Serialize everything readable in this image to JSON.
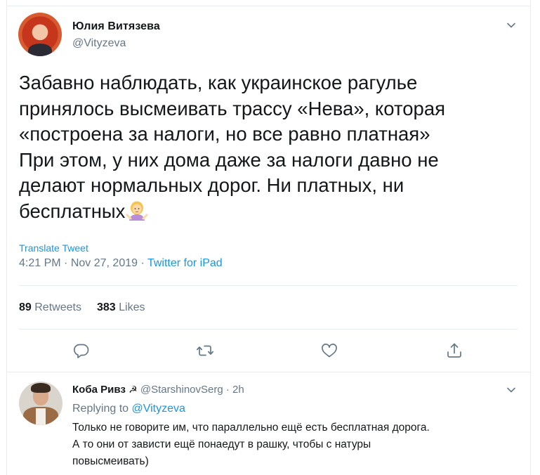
{
  "tweet": {
    "author": {
      "name": "Юлия Витязева",
      "handle": "@Vityzeva"
    },
    "text_lines": [
      "Забавно наблюдать, как украинское рагулье",
      "принялось высмеивать трассу «Нева», которая",
      "«построена за налоги, но все равно платная»",
      "При этом, у них дома даже за налоги давно не",
      "делают нормальных дорог.  Ни платных, ни",
      "бесплатных"
    ],
    "emoji": "woman-shrugging-emoji",
    "translate_label": "Translate Tweet",
    "time": "4:21 PM",
    "date": "Nov 27, 2019",
    "separator": "·",
    "source": "Twitter for iPad",
    "stats": {
      "retweets_count": "89",
      "retweets_label": "Retweets",
      "likes_count": "383",
      "likes_label": "Likes"
    },
    "actions": [
      {
        "name": "reply",
        "icon": "reply-icon"
      },
      {
        "name": "retweet",
        "icon": "retweet-icon"
      },
      {
        "name": "like",
        "icon": "heart-icon"
      },
      {
        "name": "share",
        "icon": "share-icon"
      }
    ]
  },
  "reply": {
    "author": {
      "name": "Коба Ривз",
      "symbol": "☭",
      "handle": "@StarshinovSerg",
      "time": "2h"
    },
    "separator": "·",
    "replying_label": "Replying to",
    "replying_to": "@Vityzeva",
    "text_lines": [
      "Только не говорите им, что параллельно ещё есть бесплатная дорога.",
      "А то они от зависти ещё понаедут в рашку, чтобы с натуры",
      "повысмеивать)"
    ]
  },
  "colors": {
    "link": "#1b95e0",
    "secondary_text": "#657786",
    "primary_text": "#14171a",
    "divider": "#e6ecf0"
  }
}
